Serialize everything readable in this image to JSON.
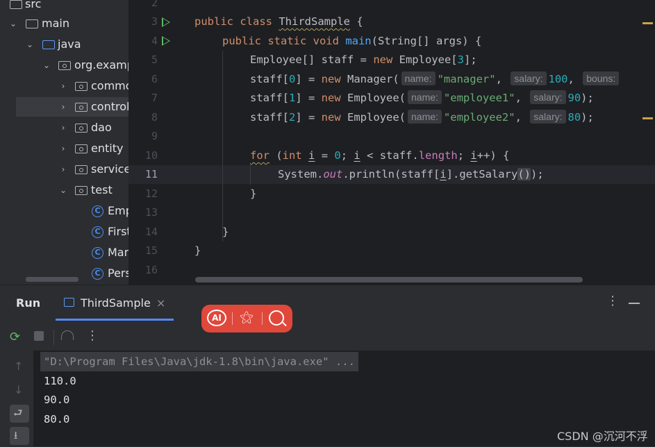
{
  "project_tree": {
    "items": [
      {
        "label": "src",
        "kind": "folder"
      },
      {
        "label": "main",
        "kind": "folder"
      },
      {
        "label": "java",
        "kind": "source-folder"
      },
      {
        "label": "org.examp",
        "kind": "package"
      },
      {
        "label": "commo",
        "kind": "package"
      },
      {
        "label": "control",
        "kind": "package",
        "selected": true
      },
      {
        "label": "dao",
        "kind": "package"
      },
      {
        "label": "entity",
        "kind": "package"
      },
      {
        "label": "service",
        "kind": "package"
      },
      {
        "label": "test",
        "kind": "package"
      },
      {
        "label": "Emp",
        "kind": "class"
      },
      {
        "label": "First",
        "kind": "class"
      },
      {
        "label": "Man",
        "kind": "class"
      },
      {
        "label": "Pers",
        "kind": "class"
      }
    ],
    "class_icon_letter": "C"
  },
  "editor": {
    "line_numbers": [
      "2",
      "3",
      "4",
      "5",
      "6",
      "7",
      "8",
      "9",
      "10",
      "11",
      "12",
      "13",
      "14",
      "15",
      "16"
    ],
    "current_line": "11",
    "code": {
      "l3_kw": "public class ",
      "l3_name": "ThirdSample",
      "l3_rest": " {",
      "l4_kw": "public static void ",
      "l4_fn": "main",
      "l4_rest": "(String[] args) {",
      "l5_a": "Employee[] staff = ",
      "l5_kw": "new",
      "l5_b": " Employee[",
      "l5_num": "3",
      "l5_c": "];",
      "l6_a": "staff[",
      "l6_idx": "0",
      "l6_b": "] = ",
      "l6_kw": "new",
      "l6_c": " Manager(",
      "l6_hint1": "name:",
      "l6_str": "\"manager\"",
      "l6_d": ",",
      "l6_hint2": "salary:",
      "l6_num": "100",
      "l6_e": ",",
      "l6_hint3": "bouns:",
      "l7_a": "staff[",
      "l7_idx": "1",
      "l7_b": "] = ",
      "l7_kw": "new",
      "l7_c": " Employee(",
      "l7_hint1": "name:",
      "l7_str": "\"employee1\"",
      "l7_d": ",",
      "l7_hint2": "salary:",
      "l7_num": "90",
      "l7_e": ");",
      "l8_a": "staff[",
      "l8_idx": "2",
      "l8_b": "] = ",
      "l8_kw": "new",
      "l8_c": " Employee(",
      "l8_hint1": "name:",
      "l8_str": "\"employee2\"",
      "l8_d": ",",
      "l8_hint2": "salary:",
      "l8_num": "80",
      "l8_e": ");",
      "l10_for": "for",
      "l10_a": " (",
      "l10_int": "int",
      "l10_b": " ",
      "l10_i1": "i",
      "l10_c": " = ",
      "l10_zero": "0",
      "l10_d": "; ",
      "l10_i2": "i",
      "l10_e": " < staff.",
      "l10_len": "length",
      "l10_f": "; ",
      "l10_i3": "i",
      "l10_g": "++) {",
      "l11_a": "System.",
      "l11_out": "out",
      "l11_b": ".println(staff[",
      "l11_i": "i",
      "l11_c": "].getSalary",
      "l11_p": "()",
      "l11_d": ");",
      "l12": "}",
      "l14": "}",
      "l15": "}"
    }
  },
  "run_panel": {
    "title": "Run",
    "tab_label": "ThirdSample",
    "tab_close": "×",
    "more": "⋮",
    "console": {
      "command": "\"D:\\Program Files\\Java\\jdk-1.8\\bin\\java.exe\" ...",
      "lines": [
        "110.0",
        "90.0",
        "80.0"
      ]
    }
  },
  "overlay": {
    "ai_label": "AI"
  },
  "watermark": "CSDN @沉河不浮",
  "colors": {
    "keyword": "#cf8e6d",
    "function": "#56a8f5",
    "number": "#2aacb8",
    "string": "#6aab73",
    "field": "#c77dbb",
    "run_green": "#5fb865",
    "pill_red": "#e0483c"
  }
}
